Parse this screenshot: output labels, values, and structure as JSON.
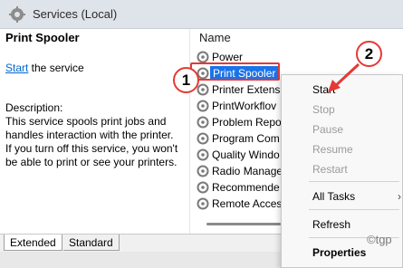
{
  "window": {
    "title": "Services (Local)"
  },
  "details": {
    "service_name": "Print Spooler",
    "start_link": "Start",
    "start_suffix": " the service",
    "description_label": "Description:",
    "description_lines": [
      "This service spools print jobs and",
      "handles interaction with the printer.",
      "If you turn off this service, you won't",
      "be able to print or see your printers."
    ]
  },
  "list": {
    "column_header": "Name",
    "rows": [
      {
        "name": "Power"
      },
      {
        "name": "Print Spooler",
        "selected": true
      },
      {
        "name": "Printer Extens"
      },
      {
        "name": "PrintWorkflov"
      },
      {
        "name": "Problem Repo"
      },
      {
        "name": "Program Com"
      },
      {
        "name": "Quality Windo"
      },
      {
        "name": "Radio Manage"
      },
      {
        "name": "Recommende"
      },
      {
        "name": "Remote Acces"
      }
    ]
  },
  "context_menu": {
    "start": "Start",
    "stop": "Stop",
    "pause": "Pause",
    "resume": "Resume",
    "restart": "Restart",
    "all_tasks": "All Tasks",
    "refresh": "Refresh",
    "properties": "Properties",
    "submenu_arrow": "›"
  },
  "tabs": {
    "extended": "Extended",
    "standard": "Standard"
  },
  "annotations": {
    "marker1": "1",
    "marker2": "2"
  },
  "watermark": "©tgp",
  "colors": {
    "accent": "#1a73e8",
    "annotation_red": "#e53935",
    "link": "#0066cc"
  }
}
